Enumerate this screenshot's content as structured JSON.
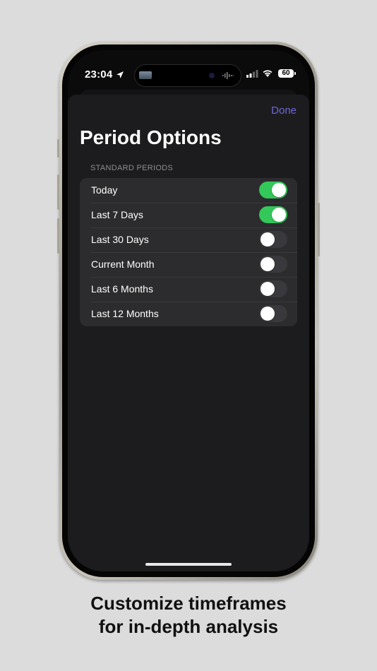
{
  "status_bar": {
    "time": "23:04",
    "battery_level": "60"
  },
  "sheet": {
    "done_label": "Done",
    "title": "Period Options",
    "section_header": "STANDARD PERIODS",
    "items": [
      {
        "label": "Today",
        "on": true
      },
      {
        "label": "Last 7 Days",
        "on": true
      },
      {
        "label": "Last 30 Days",
        "on": false
      },
      {
        "label": "Current Month",
        "on": false
      },
      {
        "label": "Last 6 Months",
        "on": false
      },
      {
        "label": "Last 12 Months",
        "on": false
      }
    ]
  },
  "caption": {
    "line1": "Customize timeframes",
    "line2": "for in-depth analysis"
  },
  "colors": {
    "accent": "#6e68d8",
    "toggle_on": "#34c759",
    "toggle_off": "#39393d",
    "sheet_background": "#1c1c1e",
    "list_background": "#2c2c2e"
  },
  "icons": [
    "location-arrow-icon",
    "signal-icon",
    "wifi-icon",
    "battery-icon"
  ]
}
